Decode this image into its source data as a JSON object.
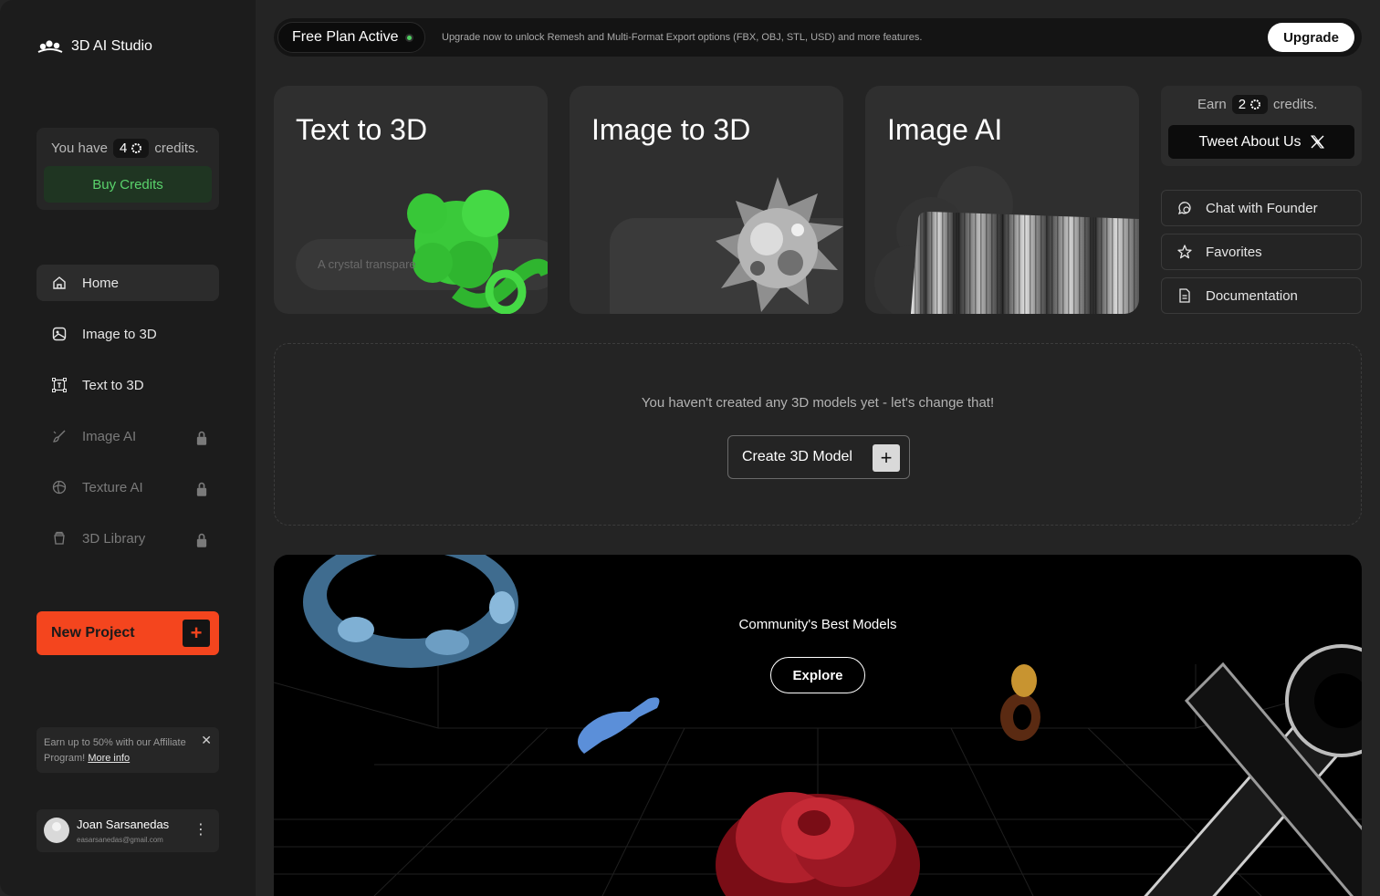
{
  "app": {
    "title": "3D AI Studio"
  },
  "credits": {
    "prefix": "You have",
    "amount": "4",
    "suffix": "credits.",
    "buy_label": "Buy Credits"
  },
  "nav": [
    {
      "label": "Home",
      "icon": "home-icon",
      "active": true,
      "locked": false
    },
    {
      "label": "Image to 3D",
      "icon": "image-3d-icon",
      "active": false,
      "locked": false
    },
    {
      "label": "Text to 3D",
      "icon": "text-3d-icon",
      "active": false,
      "locked": false
    },
    {
      "label": "Image AI",
      "icon": "brush-icon",
      "active": false,
      "locked": true
    },
    {
      "label": "Texture AI",
      "icon": "globe-icon",
      "active": false,
      "locked": true
    },
    {
      "label": "3D Library",
      "icon": "library-icon",
      "active": false,
      "locked": true
    }
  ],
  "new_project": {
    "label": "New Project",
    "plus": "+"
  },
  "affiliate": {
    "text": "Earn up to 50% with our Affiliate Program!",
    "link": "More info",
    "close": "✕"
  },
  "user": {
    "name": "Joan Sarsanedas",
    "email": "easarsanedas@gmail.com",
    "menu": "⋮"
  },
  "banner": {
    "plan": "Free Plan Active",
    "text": "Upgrade now to unlock Remesh and Multi-Format Export options (FBX, OBJ, STL, USD) and more features.",
    "upgrade": "Upgrade"
  },
  "cards": [
    {
      "title": "Text to 3D",
      "prompt_preview": "A crystal transpare"
    },
    {
      "title": "Image to 3D"
    },
    {
      "title": "Image AI"
    }
  ],
  "earn": {
    "prefix": "Earn",
    "amount": "2",
    "suffix": "credits.",
    "tweet": "Tweet About Us"
  },
  "links": [
    {
      "label": "Chat with Founder",
      "icon": "chat-icon"
    },
    {
      "label": "Favorites",
      "icon": "star-icon"
    },
    {
      "label": "Documentation",
      "icon": "document-icon"
    }
  ],
  "empty_state": {
    "text": "You haven't created any 3D models yet - let's change that!",
    "button": "Create 3D Model",
    "plus": "+"
  },
  "community": {
    "title": "Community's Best Models",
    "button": "Explore"
  },
  "colors": {
    "accent": "#f4451e",
    "green": "#5ad36c",
    "background": "#242424",
    "sidebar": "#1c1c1c"
  }
}
